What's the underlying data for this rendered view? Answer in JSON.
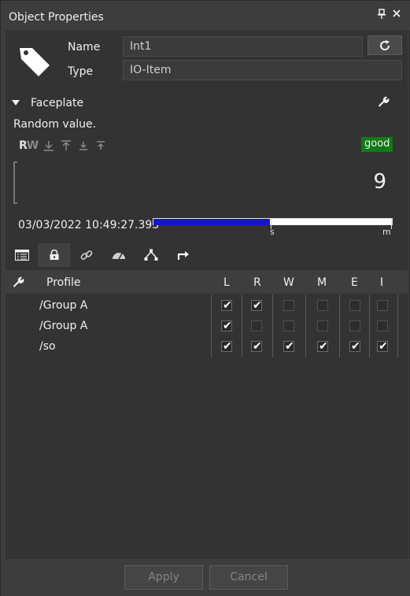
{
  "window": {
    "title": "Object Properties"
  },
  "header": {
    "name_label": "Name",
    "name_value": "Int1",
    "type_label": "Type",
    "type_value": "IO-Item"
  },
  "faceplate": {
    "section_label": "Faceplate",
    "description": "Random value.",
    "access": {
      "read": "R",
      "write": "W"
    },
    "quality": "good",
    "quality_color": "#0f7a14",
    "value": "9",
    "timestamp": "03/03/2022 10:49:27.393",
    "age_bar": {
      "fill_fraction": 0.49,
      "fill_color": "#1414d8",
      "tick_labels": [
        "s",
        "m"
      ]
    }
  },
  "tabs": [
    {
      "icon": "list-icon",
      "active": false
    },
    {
      "icon": "lock-icon",
      "active": true
    },
    {
      "icon": "link-icon",
      "active": false
    },
    {
      "icon": "gauge-icon",
      "active": false
    },
    {
      "icon": "hierarchy-icon",
      "active": false
    },
    {
      "icon": "route-icon",
      "active": false
    }
  ],
  "permissions": {
    "columns": [
      "Profile",
      "L",
      "R",
      "W",
      "M",
      "E",
      "I"
    ],
    "rows": [
      {
        "profile": "/Group A",
        "L": true,
        "R": true,
        "W": false,
        "M": false,
        "E": false,
        "I": false
      },
      {
        "profile": "/Group A",
        "L": true,
        "R": false,
        "W": false,
        "M": false,
        "E": false,
        "I": false
      },
      {
        "profile": "/so",
        "L": true,
        "R": true,
        "W": true,
        "M": true,
        "E": true,
        "I": true
      }
    ]
  },
  "footer": {
    "apply_label": "Apply",
    "cancel_label": "Cancel"
  },
  "checkmark": "✔"
}
